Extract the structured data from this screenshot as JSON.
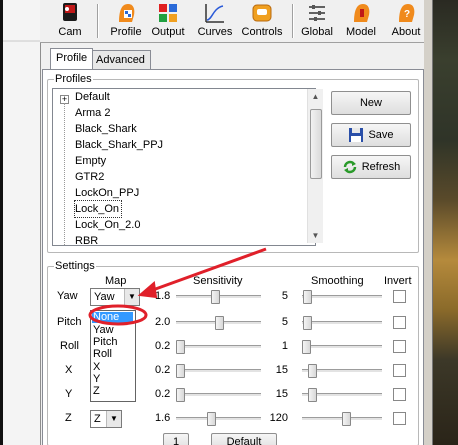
{
  "toolbar": {
    "buttons": [
      {
        "label": "Cam",
        "icon": "camera-icon"
      },
      {
        "label": "Profile",
        "icon": "profile-icon"
      },
      {
        "label": "Output",
        "icon": "output-icon"
      },
      {
        "label": "Curves",
        "icon": "curves-icon"
      },
      {
        "label": "Controls",
        "icon": "controls-icon"
      },
      {
        "label": "Global",
        "icon": "global-sliders-icon"
      },
      {
        "label": "Model",
        "icon": "model-head-icon"
      },
      {
        "label": "About",
        "icon": "about-head-icon"
      }
    ]
  },
  "tabs": [
    "Profile",
    "Advanced"
  ],
  "profiles": {
    "title": "Profiles",
    "items": [
      "Default",
      "Arma 2",
      "Black_Shark",
      "Black_Shark_PPJ",
      "Empty",
      "GTR2",
      "LockOn_PPJ",
      "Lock_On",
      "Lock_On_2.0",
      "RBR"
    ],
    "selected": "Lock_On"
  },
  "actions": {
    "new": "New",
    "save": "Save",
    "refresh": "Refresh"
  },
  "settings": {
    "title": "Settings",
    "headers": {
      "map": "Map",
      "sensitivity": "Sensitivity",
      "smoothing": "Smoothing",
      "invert": "Invert"
    },
    "rows": [
      {
        "label": "Yaw",
        "map": "Yaw",
        "sensitivity": "1.8",
        "smoothing": "5",
        "slider_sens": 0.45,
        "slider_smooth": 0.02
      },
      {
        "label": "Pitch",
        "map": "",
        "sensitivity": "2.0",
        "smoothing": "5",
        "slider_sens": 0.5,
        "slider_smooth": 0.02
      },
      {
        "label": "Roll",
        "map": "",
        "sensitivity": "0.2",
        "smoothing": "1",
        "slider_sens": 0.0,
        "slider_smooth": 0.0
      },
      {
        "label": "X",
        "map": "",
        "sensitivity": "0.2",
        "smoothing": "15",
        "slider_sens": 0.0,
        "slider_smooth": 0.08
      },
      {
        "label": "Y",
        "map": "",
        "sensitivity": "0.2",
        "smoothing": "15",
        "slider_sens": 0.0,
        "slider_smooth": 0.08
      },
      {
        "label": "Z",
        "map": "Z",
        "sensitivity": "1.6",
        "smoothing": "120",
        "slider_sens": 0.4,
        "slider_smooth": 0.55
      }
    ],
    "dropdown_options": [
      "None",
      "Yaw",
      "Pitch",
      "Roll",
      "X",
      "Y",
      "Z"
    ],
    "dropdown_highlighted": "None"
  },
  "bottom": {
    "number_button": "1",
    "default_button": "Default"
  },
  "colors": {
    "annotation_red": "#e0202a",
    "highlight_blue": "#3399ff"
  }
}
